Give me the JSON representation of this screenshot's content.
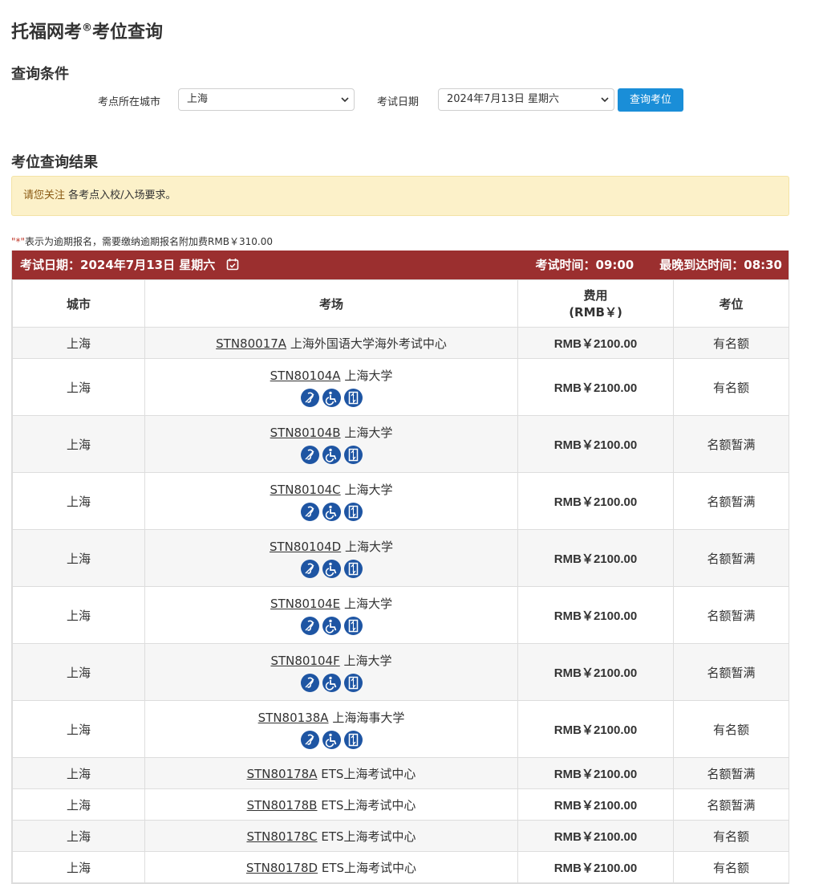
{
  "page_title": "托福网考",
  "page_title_sup": "®",
  "page_title_tail": "考位查询",
  "query_section_title": "查询条件",
  "city_label": "考点所在城市",
  "city_value": "上海",
  "date_label": "考试日期",
  "date_value": "2024年7月13日 星期六",
  "search_button": "查询考位",
  "results_title": "考位查询结果",
  "notice": {
    "highlight": "请您关注",
    "text": " 各考点入校/入场要求。"
  },
  "late_note": {
    "mark": "\"*\"",
    "text": "表示为逾期报名，需要缴纳逾期报名附加费RMB￥310.00"
  },
  "bar": {
    "date_label": "考试日期：",
    "date_value": "2024年7月13日 星期六",
    "time": "考试时间：09:00",
    "arrival": "最晚到达时间：08:30"
  },
  "columns": {
    "city": "城市",
    "center": "考场",
    "fee_line1": "费用",
    "fee_line2": "(RMB￥)",
    "seat": "考位"
  },
  "rows": [
    {
      "city": "上海",
      "code": "STN80017A",
      "name": "上海外国语大学海外考试中心",
      "fee": "RMB￥2100.00",
      "seat": "有名额",
      "icons": false
    },
    {
      "city": "上海",
      "code": "STN80104A",
      "name": "上海大学",
      "fee": "RMB￥2100.00",
      "seat": "有名额",
      "icons": true
    },
    {
      "city": "上海",
      "code": "STN80104B",
      "name": "上海大学",
      "fee": "RMB￥2100.00",
      "seat": "名额暂满",
      "icons": true
    },
    {
      "city": "上海",
      "code": "STN80104C",
      "name": "上海大学",
      "fee": "RMB￥2100.00",
      "seat": "名额暂满",
      "icons": true
    },
    {
      "city": "上海",
      "code": "STN80104D",
      "name": "上海大学",
      "fee": "RMB￥2100.00",
      "seat": "名额暂满",
      "icons": true
    },
    {
      "city": "上海",
      "code": "STN80104E",
      "name": "上海大学",
      "fee": "RMB￥2100.00",
      "seat": "名额暂满",
      "icons": true
    },
    {
      "city": "上海",
      "code": "STN80104F",
      "name": "上海大学",
      "fee": "RMB￥2100.00",
      "seat": "名额暂满",
      "icons": true
    },
    {
      "city": "上海",
      "code": "STN80138A",
      "name": "上海海事大学",
      "fee": "RMB￥2100.00",
      "seat": "有名额",
      "icons": true
    },
    {
      "city": "上海",
      "code": "STN80178A",
      "name": "ETS上海考试中心",
      "fee": "RMB￥2100.00",
      "seat": "名额暂满",
      "icons": false
    },
    {
      "city": "上海",
      "code": "STN80178B",
      "name": "ETS上海考试中心",
      "fee": "RMB￥2100.00",
      "seat": "名额暂满",
      "icons": false
    },
    {
      "city": "上海",
      "code": "STN80178C",
      "name": "ETS上海考试中心",
      "fee": "RMB￥2100.00",
      "seat": "有名额",
      "icons": false
    },
    {
      "city": "上海",
      "code": "STN80178D",
      "name": "ETS上海考试中心",
      "fee": "RMB￥2100.00",
      "seat": "有名额",
      "icons": false
    }
  ],
  "icon_names": [
    "hearing-assist-icon",
    "wheelchair-icon",
    "elevator-icon"
  ],
  "colors": {
    "header_bar": "#9b2f2f",
    "button": "#1a8ed8",
    "notice_bg": "#fcf1c9",
    "icon_bg": "#1e55a3"
  }
}
